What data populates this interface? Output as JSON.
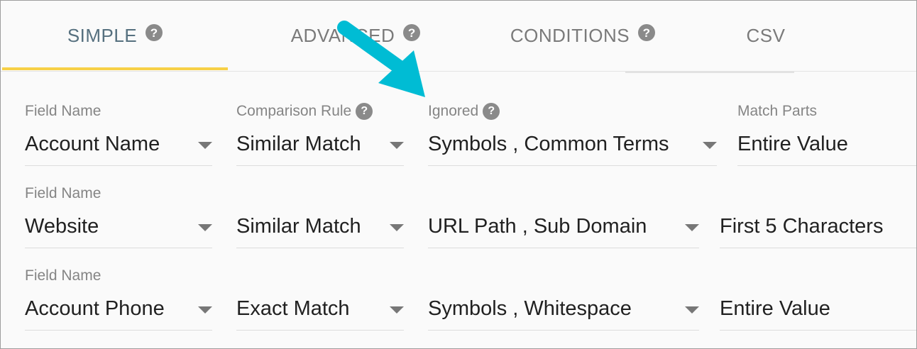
{
  "tabs": [
    {
      "label": "SIMPLE",
      "active": true,
      "has_help": true
    },
    {
      "label": "ADVANCED",
      "active": false,
      "has_help": true
    },
    {
      "label": "CONDITIONS",
      "active": false,
      "has_help": true
    },
    {
      "label": "CSV",
      "active": false,
      "has_help": false
    }
  ],
  "help_glyph": "?",
  "labels": {
    "field_name": "Field Name",
    "comparison_rule": "Comparison Rule",
    "ignored": "Ignored",
    "match_parts": "Match Parts"
  },
  "rows": [
    {
      "field": "Account Name",
      "comparison": "Similar Match",
      "ignored": "Symbols , Common Terms",
      "match_parts": "Entire Value"
    },
    {
      "field": "Website",
      "comparison": "Similar Match",
      "ignored": "URL Path , Sub Domain",
      "match_parts": "First 5 Characters"
    },
    {
      "field": "Account Phone",
      "comparison": "Exact Match",
      "ignored": "Symbols , Whitespace",
      "match_parts": "Entire Value"
    }
  ],
  "colors": {
    "active_tab_text": "#56707f",
    "tab_indicator": "#f7d046",
    "arrow": "#00bcd4",
    "help_icon": "#8a8a8a"
  }
}
